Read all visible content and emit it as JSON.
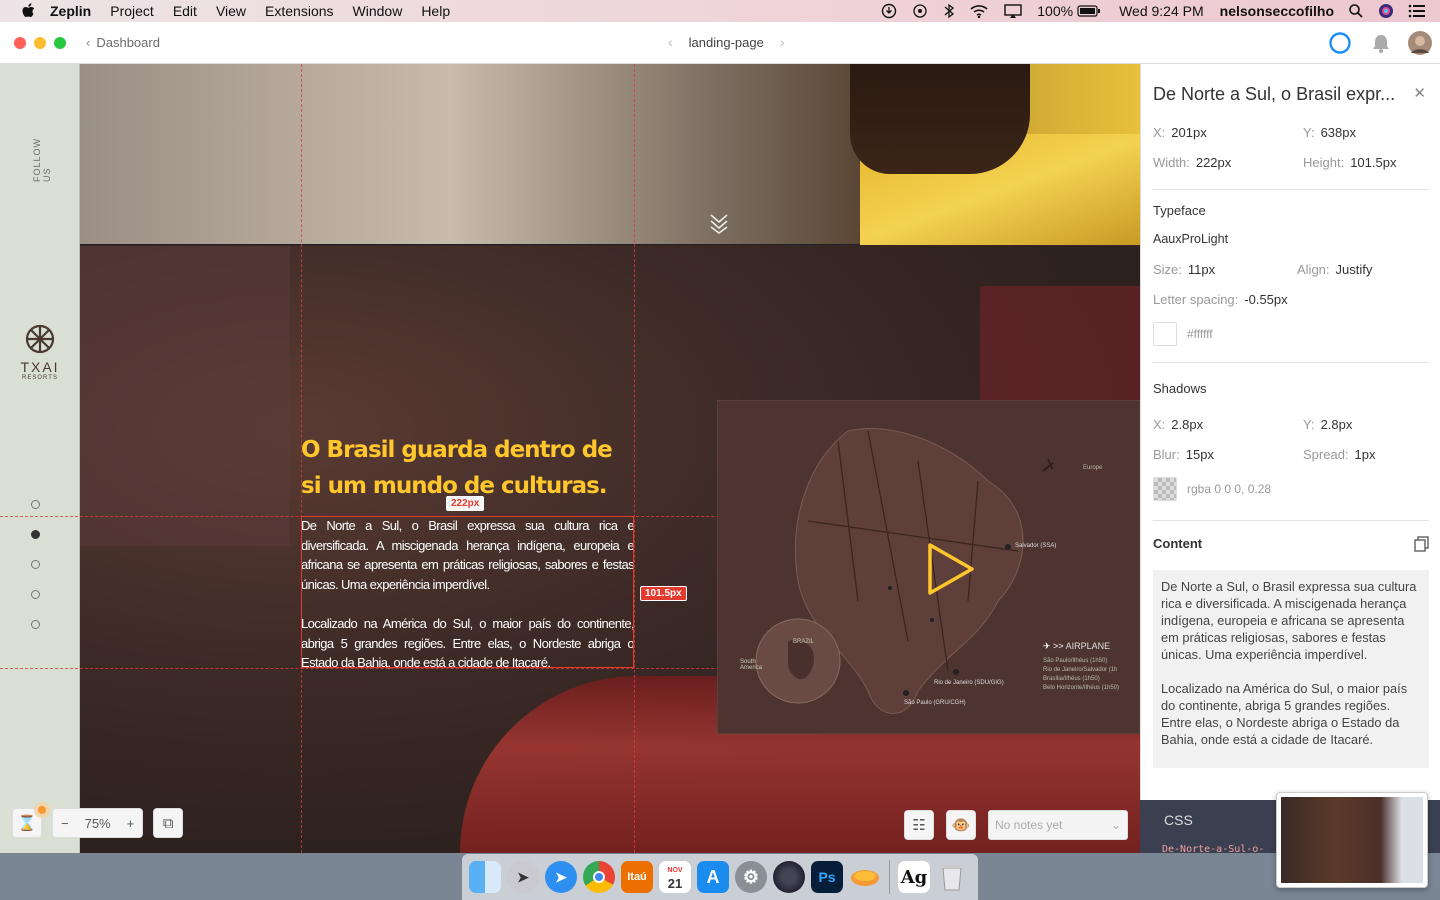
{
  "menubar": {
    "app": "Zeplin",
    "items": [
      "Project",
      "Edit",
      "View",
      "Extensions",
      "Window",
      "Help"
    ],
    "battery": "100%",
    "clock": "Wed 9:24 PM",
    "user": "nelsonseccofilho"
  },
  "toolbar": {
    "back_label": "Dashboard",
    "screen_name": "landing-page"
  },
  "canvas": {
    "follow_us": "FOLLOW US",
    "brand_name": "TXAI",
    "brand_sub": "RESORTS",
    "headline_line1": "O Brasil guarda dentro de",
    "headline_line2": "si um mundo de culturas.",
    "body_p1": "De Norte a Sul, o Brasil expressa sua cultura rica e diversificada. A miscigenada herança indígena, europeia e africana se apresenta em práticas religiosas, sabores e festas únicas. Uma experiência imperdível.",
    "body_p2": "Localizado na América do Sul, o maior país do continente, abriga 5 grandes regiões. Entre elas, o Nordeste abriga o Estado da Bahia, onde está a cidade de Itacaré.",
    "width_tag": "222px",
    "height_tag": "101.5px",
    "map_airplane": "AIRPLANE",
    "map_city1": "Salvador (SSA)",
    "map_city2": "Rio de Janeiro (SDU/GIG)",
    "map_city3": "São Paulo (GRU/CGH)",
    "map_europe": "Europe",
    "map_brazil": "BRAZIL",
    "map_south_america": "South America",
    "map_routes": [
      "São Paulo/Ilhéus (1h50)",
      "Rio de Janeiro/Salvador (1h",
      "Brasília/Ilhéus (1h50)",
      "Belo Horizonte/Ilhéus (1h50)"
    ]
  },
  "controls": {
    "zoom": "75%",
    "notes_placeholder": "No notes yet"
  },
  "panel": {
    "title": "De Norte a Sul, o Brasil expr...",
    "x_label": "X:",
    "x_value": "201px",
    "y_label": "Y:",
    "y_value": "638px",
    "width_label": "Width:",
    "width_value": "222px",
    "height_label": "Height:",
    "height_value": "101.5px",
    "typeface_header": "Typeface",
    "typeface_value": "AauxProLight",
    "size_label": "Size:",
    "size_value": "11px",
    "align_label": "Align:",
    "align_value": "Justify",
    "ls_label": "Letter spacing:",
    "ls_value": "-0.55px",
    "color_value": "#ffffff",
    "shadows_header": "Shadows",
    "sx_label": "X:",
    "sx_value": "2.8px",
    "sy_label": "Y:",
    "sy_value": "2.8px",
    "blur_label": "Blur:",
    "blur_value": "15px",
    "spread_label": "Spread:",
    "spread_value": "1px",
    "shadow_color": "rgba 0 0 0, 0.28",
    "content_header": "Content",
    "content_p1": "De Norte a Sul, o Brasil expressa sua cultura rica e diversificada. A miscigenada herança indígena, europeia e africana se apresenta em práticas religiosas, sabores e festas únicas. Uma experiência imperdível.",
    "content_p2": "Localizado na América do Sul, o maior país do continente, abriga 5 grandes regiões. Entre elas, o Nordeste abriga o Estado da Bahia, onde está a cidade de Itacaré.",
    "css_label": "CSS",
    "css_code": "De-Norte-a-Sul-o-"
  },
  "dock": {
    "itau_label": "Itaú",
    "calendar_month": "NOV",
    "calendar_day": "21",
    "ps_label": "Ps",
    "font_label": "Ag"
  },
  "colors": {
    "accent_yellow": "#ffc72c",
    "selection_red": "#e23a2f",
    "zeplin_orange": "#f69833"
  }
}
